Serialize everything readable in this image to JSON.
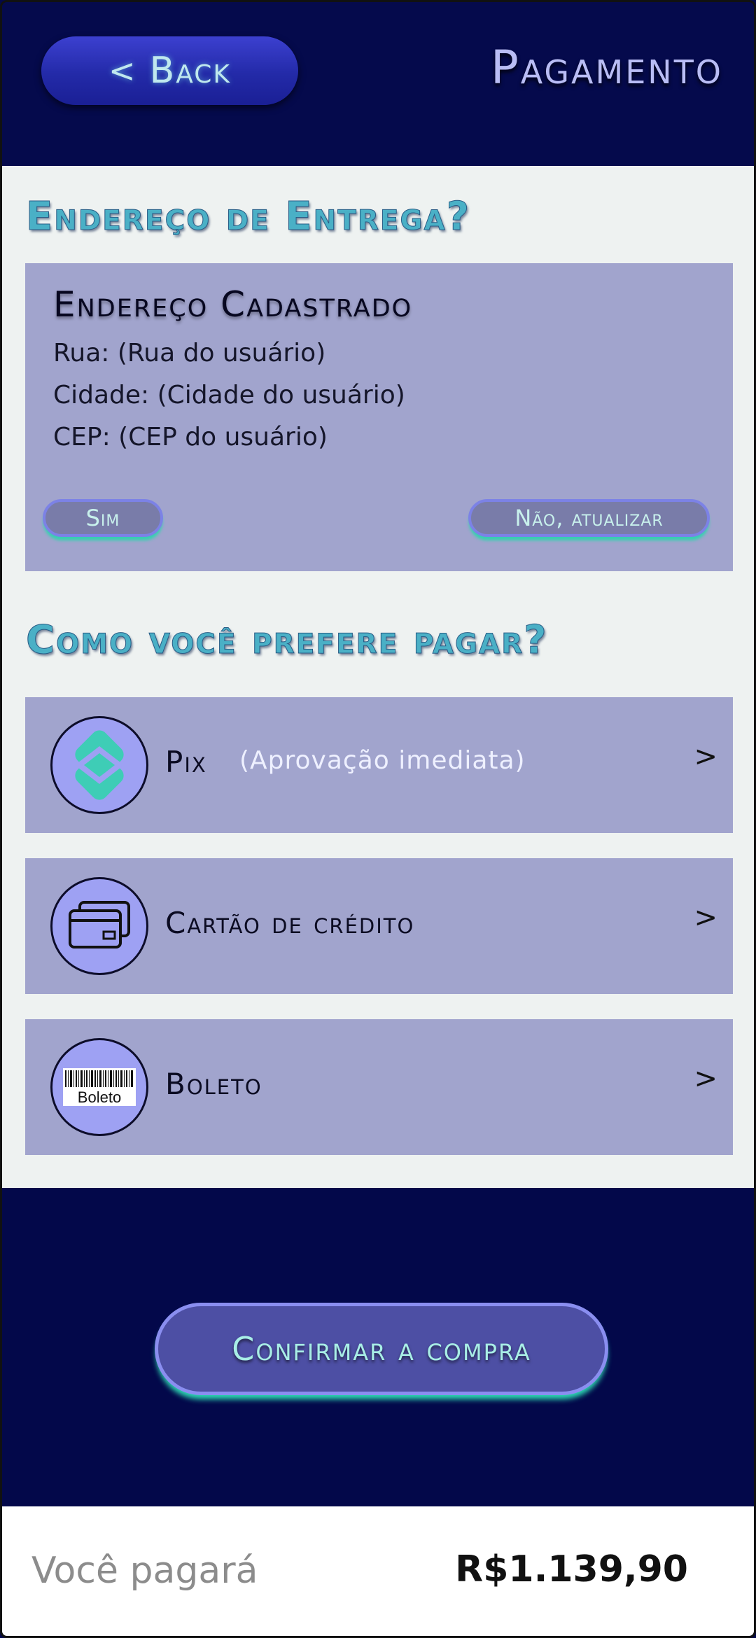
{
  "header": {
    "back_label": "Back",
    "back_chevron": "<",
    "title": "Pagamento"
  },
  "address_section": {
    "title": "Endereço de Entrega?",
    "card_title": "Endereço Cadastrado",
    "lines": [
      "Rua: (Rua do usuário)",
      "Cidade: (Cidade do usuário)",
      "CEP: (CEP do usuário)"
    ],
    "yes_label": "Sim",
    "update_label": "Não, atualizar"
  },
  "payment_section": {
    "title": "Como você prefere pagar?",
    "options": [
      {
        "label": "Pix",
        "note": "(Aprovação imediata)",
        "icon": "pix-icon",
        "chevron": ">"
      },
      {
        "label": "Cartão de crédito",
        "icon": "credit-card-icon",
        "chevron": ">"
      },
      {
        "label": "Boleto",
        "icon": "boleto-barcode-icon",
        "icon_text": "Boleto",
        "chevron": ">"
      }
    ]
  },
  "confirm_label": "Confirmar a compra",
  "footer": {
    "total_label": "Você pagará",
    "total_value": "R$1.139,90"
  },
  "colors": {
    "background_dark": "#03084a",
    "card": "#a1a4cd",
    "accent_teal": "#2ed9b4",
    "pix_teal": "#3ecdb6"
  }
}
